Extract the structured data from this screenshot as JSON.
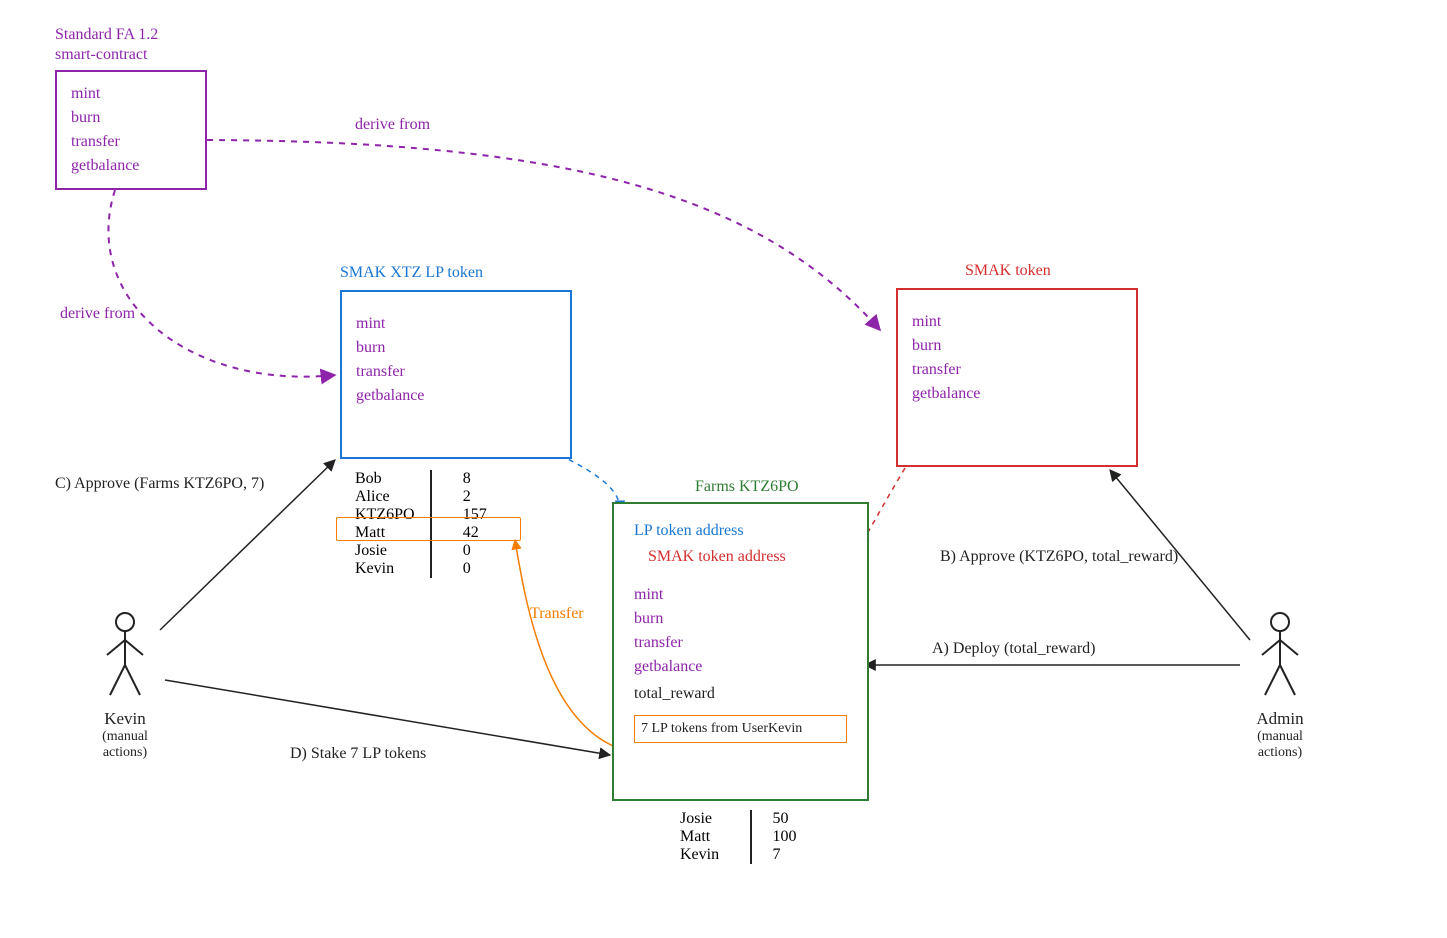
{
  "colors": {
    "purple": "#8e24aa",
    "blue": "#1976d2",
    "red": "#d32f2f",
    "green": "#2e7d32",
    "orange": "#f57c00",
    "black": "#222"
  },
  "standard_contract": {
    "title_line1": "Standard FA 1.2",
    "title_line2": "smart-contract",
    "methods": [
      "mint",
      "burn",
      "transfer",
      "getbalance"
    ]
  },
  "lp_token": {
    "title": "SMAK XTZ LP token",
    "methods": [
      "mint",
      "burn",
      "transfer",
      "getbalance"
    ],
    "balances": [
      {
        "name": "Bob",
        "value": 8
      },
      {
        "name": "Alice",
        "value": 2
      },
      {
        "name": "KTZ6PO",
        "value": 157,
        "highlight": true
      },
      {
        "name": "Matt",
        "value": 42
      },
      {
        "name": "Josie",
        "value": 0
      },
      {
        "name": "Kevin",
        "value": 0
      }
    ]
  },
  "smak_token": {
    "title": "SMAK token",
    "methods": [
      "mint",
      "burn",
      "transfer",
      "getbalance"
    ]
  },
  "farm": {
    "title": "Farms KTZ6PO",
    "lp_label": "LP token address",
    "smak_label": "SMAK token address",
    "methods": [
      "mint",
      "burn",
      "transfer",
      "getbalance"
    ],
    "extra_field": "total_reward",
    "staked_note": "7 LP tokens from UserKevin",
    "balances": [
      {
        "name": "Josie",
        "value": 50
      },
      {
        "name": "Matt",
        "value": 100
      },
      {
        "name": "Kevin",
        "value": 7
      }
    ]
  },
  "actors": {
    "kevin": {
      "name": "Kevin",
      "sub": "(manual actions)"
    },
    "admin": {
      "name": "Admin",
      "sub": "(manual actions)"
    }
  },
  "edges": {
    "derive1": "derive from",
    "derive2": "derive from",
    "approveC": "C) Approve (Farms KTZ6PO, 7)",
    "stakeD": "D) Stake 7 LP tokens",
    "deployA": "A) Deploy (total_reward)",
    "approveB": "B) Approve (KTZ6PO, total_reward)",
    "transfer": "Transfer"
  }
}
